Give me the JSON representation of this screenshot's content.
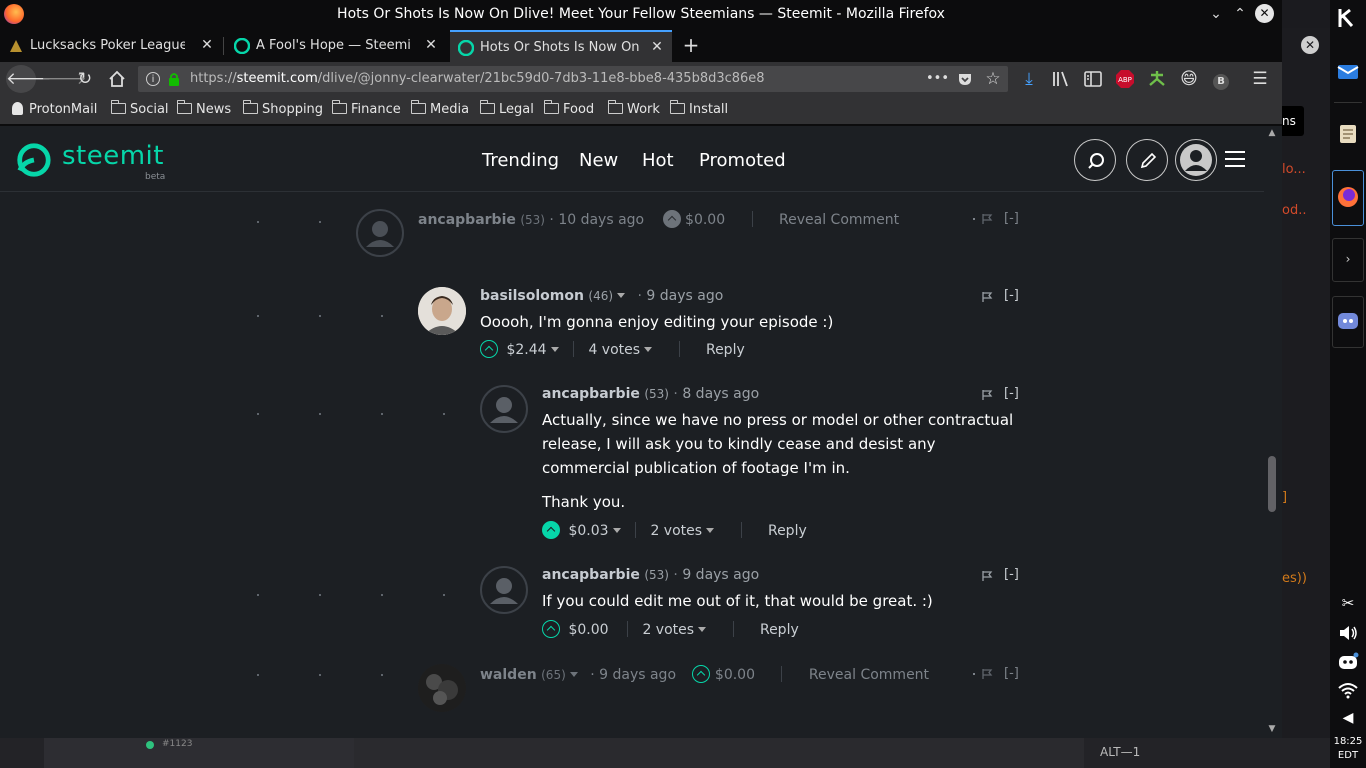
{
  "window": {
    "title": "Hots Or Shots Is Now On Dlive! Meet Your Fellow Steemians — Steemit - Mozilla Firefox",
    "minimize": "⌄",
    "maximize": "⌃",
    "close": "✕"
  },
  "tabs": [
    {
      "label": "Lucksacks Poker Leagues >",
      "active": false
    },
    {
      "label": "A Fool's Hope — Steemit",
      "active": false
    },
    {
      "label": "Hots Or Shots Is Now On Dl",
      "active": true
    }
  ],
  "newtab": "+",
  "url": {
    "prefix": "https://",
    "host": "steemit.com",
    "path": "/dlive/@jonny-clearwater/21bc59d0-7db3-11e8-bbe8-435b8d3c86e8"
  },
  "bookmarks": [
    "ProtonMail",
    "Social",
    "News",
    "Shopping",
    "Finance",
    "Media",
    "Legal",
    "Food",
    "Work",
    "Install"
  ],
  "steemit": {
    "logo": "steemit",
    "beta": "beta",
    "nav": [
      "Trending",
      "New",
      "Hot",
      "Promoted"
    ]
  },
  "comments": [
    {
      "author": "ancapbarbie",
      "rep": "(53)",
      "time": "10 days ago",
      "payout": "$0.00",
      "reveal": "Reveal Comment",
      "collapse": "[-]"
    },
    {
      "author": "basilsolomon",
      "rep": "(46)",
      "time": "9 days ago",
      "body": "Ooooh, I'm gonna enjoy editing your episode :)",
      "payout": "$2.44",
      "votes": "4 votes",
      "reply": "Reply",
      "collapse": "[-]"
    },
    {
      "author": "ancapbarbie",
      "rep": "(53)",
      "time": "8 days ago",
      "body": "Actually, since we have no press or model or other contractual release, I will ask you to kindly cease and desist any commercial publication of footage I'm in.",
      "body2": "Thank you.",
      "payout": "$0.03",
      "votes": "2 votes",
      "reply": "Reply",
      "collapse": "[-]"
    },
    {
      "author": "ancapbarbie",
      "rep": "(53)",
      "time": "9 days ago",
      "body": "If you could edit me out of it, that would be great. :)",
      "payout": "$0.00",
      "votes": "2 votes",
      "reply": "Reply",
      "collapse": "[-]"
    },
    {
      "author": "walden",
      "rep": "(65)",
      "time": "9 days ago",
      "payout": "$0.00",
      "reveal": "Reveal Comment",
      "collapse": "[-]"
    }
  ],
  "background": {
    "ns": "ns",
    "red1": "lo...",
    "red2": "od..",
    "orange1": "]",
    "orange2": "es))"
  },
  "taskbar": {
    "task1": "#1123",
    "alt": "ALT—1"
  },
  "clock": {
    "time": "18:25",
    "tz": "EDT"
  },
  "colors": {
    "accent": "#06d6a9",
    "bg": "#1c1f23"
  }
}
